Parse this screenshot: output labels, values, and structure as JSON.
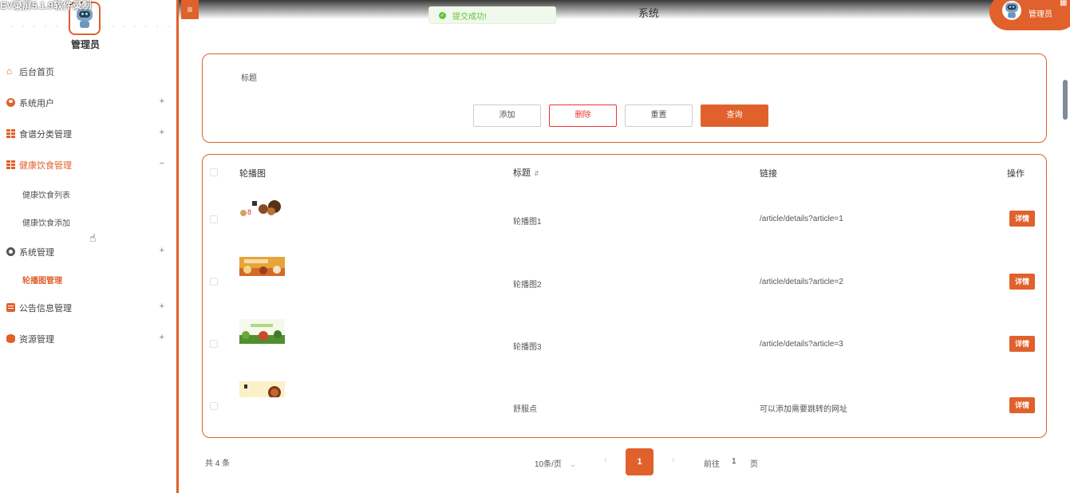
{
  "watermark": "EV录屏5.1.9软件录制",
  "sidebar": {
    "admin_name": "管理员",
    "menu": [
      {
        "label": "后台首页",
        "icon": "home-icon",
        "sign": ""
      },
      {
        "label": "系统用户",
        "icon": "user-icon",
        "sign": "+"
      },
      {
        "label": "食谱分类管理",
        "icon": "grid-icon",
        "sign": "+"
      },
      {
        "label": "健康饮食管理",
        "icon": "grid-icon",
        "sign": "−",
        "active": true,
        "children": [
          "健康饮食列表",
          "健康饮食添加"
        ]
      },
      {
        "label": "系统管理",
        "icon": "gear-icon",
        "sign": "+",
        "children": [
          "轮播图管理"
        ]
      },
      {
        "label": "公告信息管理",
        "icon": "document-icon",
        "sign": "+"
      },
      {
        "label": "资源管理",
        "icon": "database-icon",
        "sign": "+"
      }
    ]
  },
  "header": {
    "menu_toggle": "≡",
    "toast": "提交成功!",
    "title": "系统",
    "user": "管理员"
  },
  "search": {
    "label": "标题",
    "buttons": {
      "add": "添加",
      "delete": "删除",
      "reset": "重置",
      "query": "查询"
    }
  },
  "table": {
    "headers": {
      "image": "轮播图",
      "title": "标题",
      "link": "链接",
      "action": "操作"
    },
    "rows": [
      {
        "title": "轮播图1",
        "link": "/article/details?article=1",
        "action": "详情"
      },
      {
        "title": "轮播图2",
        "link": "/article/details?article=2",
        "action": "详情"
      },
      {
        "title": "轮播图3",
        "link": "/article/details?article=3",
        "action": "详情"
      },
      {
        "title": "舒服点",
        "link": "可以添加需要跳转的网址",
        "action": "详情"
      }
    ]
  },
  "pagination": {
    "total": "共 4 条",
    "page_size": "10条/页",
    "current_page": "1",
    "goto_prefix": "前往",
    "goto_value": "1",
    "goto_suffix": "页"
  },
  "colors": {
    "accent": "#e0612b",
    "success": "#67c23a",
    "danger": "#ee3333"
  }
}
